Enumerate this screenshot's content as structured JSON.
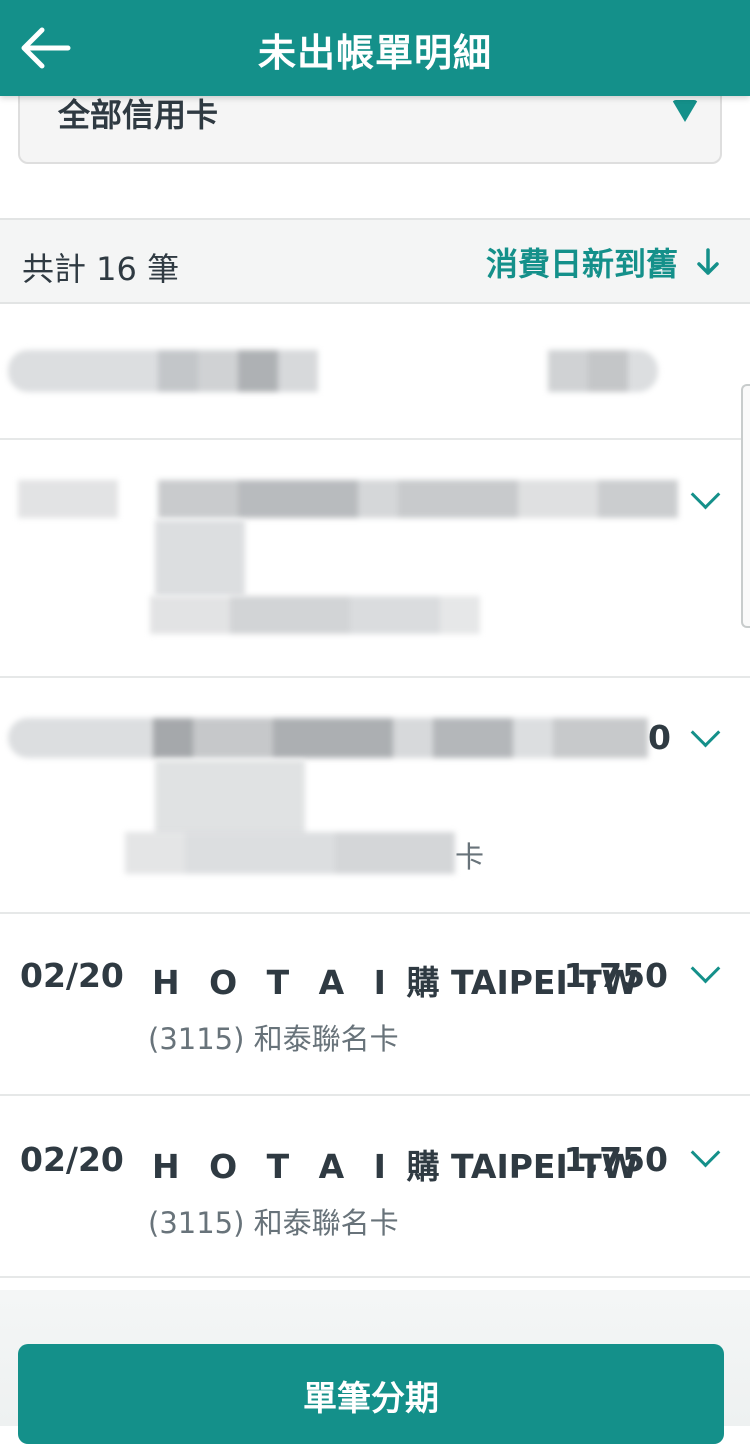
{
  "header": {
    "title": "未出帳單明細",
    "back_icon": "arrow-left-icon"
  },
  "card_filter": {
    "selected": "全部信用卡",
    "icon": "caret-down-icon"
  },
  "summary": {
    "count_text": "共計 16 筆",
    "sort_label": "消費日新到舊",
    "sort_icon": "arrow-down-icon"
  },
  "transactions": [
    {
      "date": "02/20",
      "merchant_letters": "H O T A I",
      "merchant_rest": "購 TAIPEI TW",
      "amount": "1,750",
      "card": "(3115) 和泰聯名卡"
    },
    {
      "date": "02/20",
      "merchant_letters": "H O T A I",
      "merchant_rest": "購 TAIPEI TW",
      "amount": "1,750",
      "card": "(3115) 和泰聯名卡"
    }
  ],
  "partial_glyphs": {
    "amount_tail": "0",
    "card_tail": "卡"
  },
  "footer": {
    "installment_label": "單筆分期"
  },
  "colors": {
    "primary": "#14908a",
    "text": "#2f3a42",
    "secondary_text": "#68737a"
  }
}
